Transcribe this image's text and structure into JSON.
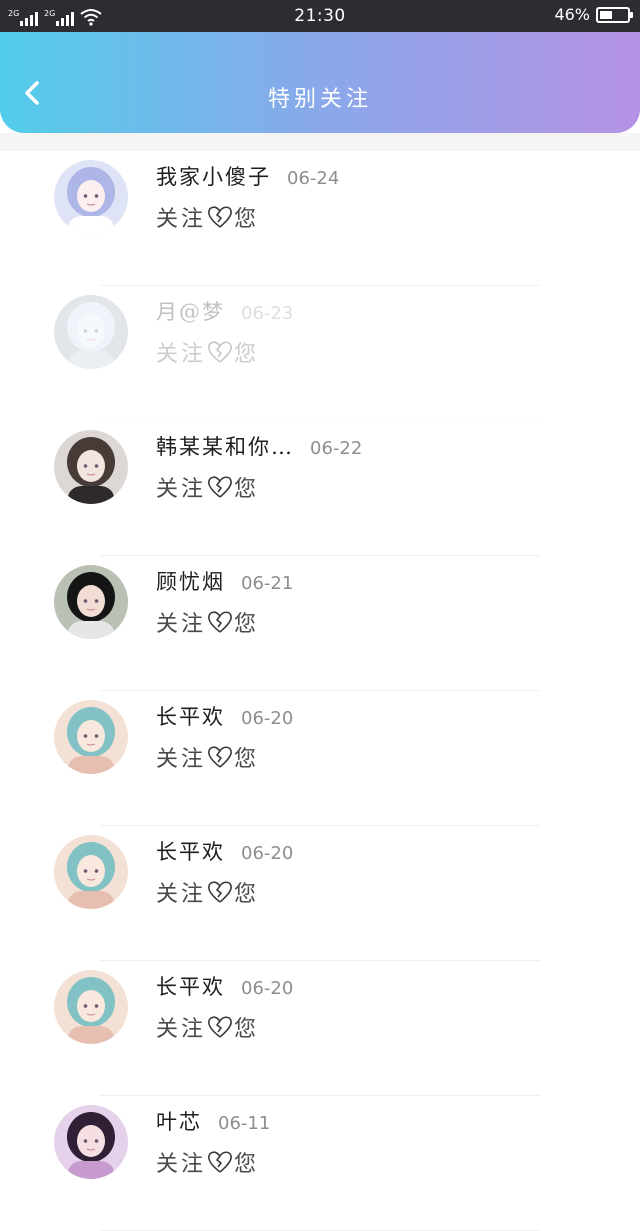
{
  "status_bar": {
    "signal1_label": "2G",
    "signal2_label": "2G",
    "time": "21:30",
    "battery_percent": "46%",
    "battery_level": 0.46,
    "icons": [
      "signal-icon",
      "signal-icon",
      "wifi-icon",
      "battery-icon"
    ]
  },
  "header": {
    "title": "特别关注",
    "back_icon": "chevron-left-icon",
    "gradient": [
      "#52cdea",
      "#b592e4"
    ]
  },
  "follow_label": {
    "before": "关注",
    "after": "您",
    "icon": "broken-heart-icon"
  },
  "items": [
    {
      "name": "我家小傻子",
      "date": "06-24"
    },
    {
      "name": "月@梦",
      "date": "06-23"
    },
    {
      "name": "韩某某和你…",
      "date": "06-22"
    },
    {
      "name": "顾忧烟",
      "date": "06-21"
    },
    {
      "name": "长平欢",
      "date": "06-20"
    },
    {
      "name": "长平欢",
      "date": "06-20"
    },
    {
      "name": "长平欢",
      "date": "06-20"
    },
    {
      "name": "叶芯",
      "date": "06-11"
    }
  ]
}
